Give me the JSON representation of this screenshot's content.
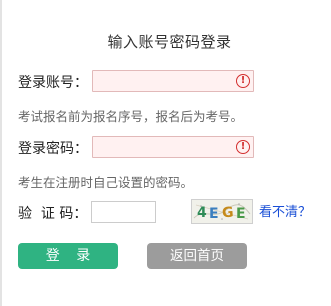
{
  "page": {
    "title": "输入账号密码登录"
  },
  "account": {
    "label": "登录账号：",
    "value": "",
    "error_icon": "exclamation-circle-icon",
    "hint": "考试报名前为报名序号，报名后为考号。"
  },
  "password": {
    "label": "登录密码：",
    "value": "",
    "error_icon": "exclamation-circle-icon",
    "hint": "考生在注册时自己设置的密码。"
  },
  "captcha": {
    "label": "验  证 码：",
    "value": "",
    "image_text": "4EGE",
    "refresh_label": "看不清？"
  },
  "buttons": {
    "login_label": "登 录",
    "home_label": "返回首页"
  },
  "colors": {
    "login_button": "#2fb382",
    "home_button": "#9c9c9c",
    "error": "#d32f2f",
    "link": "#1a4fd6",
    "input_error_bg": "#fff1f1"
  }
}
